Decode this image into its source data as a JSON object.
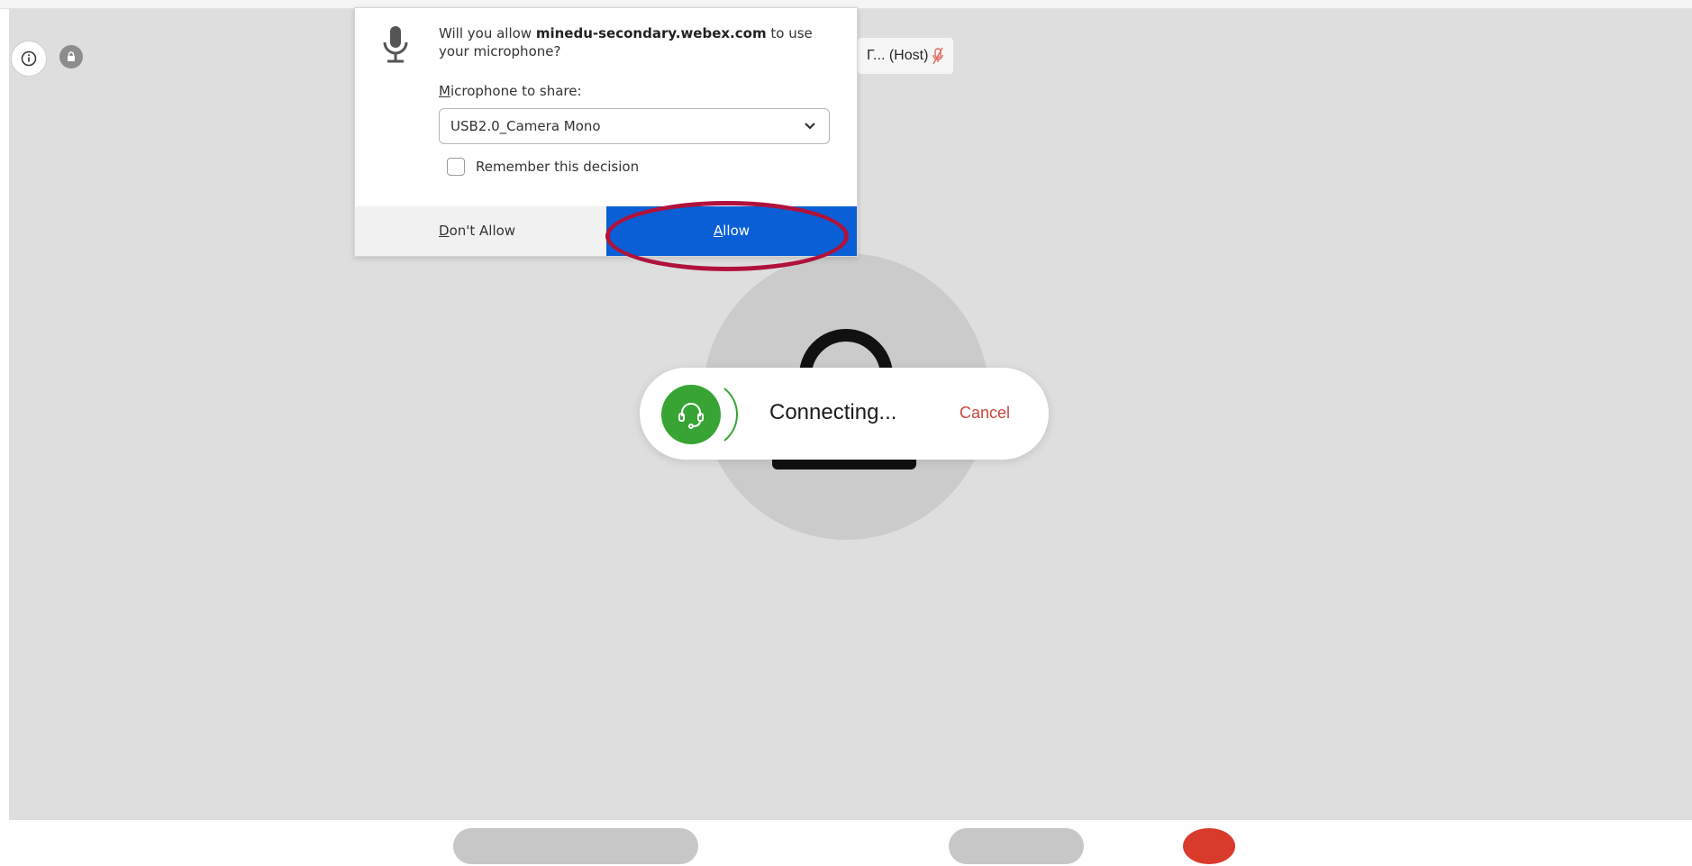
{
  "meeting": {
    "host_label": "Γ... (Host)",
    "colors": {
      "stage": "#dedede",
      "muted_mic": "#d9534f"
    }
  },
  "connecting_toast": {
    "status": "Connecting...",
    "cancel": "Cancel",
    "icon": "headset-icon",
    "color": "#37a434"
  },
  "permission_prompt": {
    "question_prefix": "Will you allow ",
    "domain": "minedu-secondary.webex.com",
    "question_suffix": " to use your microphone?",
    "share_label": "Microphone to share:",
    "selected_device": "USB2.0_Camera Mono",
    "remember": "Remember this decision",
    "dont_allow": "Don't Allow",
    "allow": "Allow",
    "icon": "microphone-icon"
  }
}
